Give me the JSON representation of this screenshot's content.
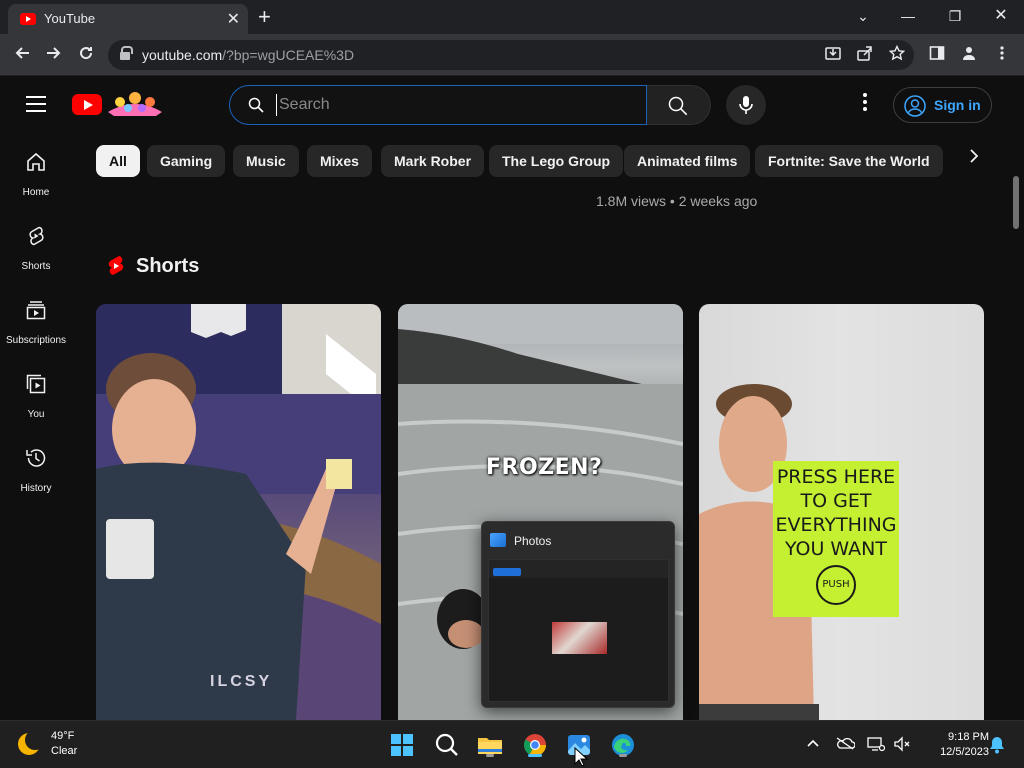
{
  "browser": {
    "tab_title": "YouTube",
    "url_host": "youtube.com",
    "url_path": "/?bp=wgUCEAE%3D",
    "window_buttons": [
      "chevron-down",
      "minimize",
      "restore",
      "close"
    ]
  },
  "youtube": {
    "search": {
      "placeholder": "Search"
    },
    "signin_label": "Sign in",
    "guide": [
      {
        "label": "Home",
        "icon": "home-icon"
      },
      {
        "label": "Shorts",
        "icon": "shorts-icon"
      },
      {
        "label": "Subscriptions",
        "icon": "subscriptions-icon"
      },
      {
        "label": "You",
        "icon": "you-icon"
      },
      {
        "label": "History",
        "icon": "history-icon"
      }
    ],
    "chips": [
      "All",
      "Gaming",
      "Music",
      "Mixes",
      "Mark Rober",
      "The Lego Group",
      "Animated films",
      "Fortnite: Save the World"
    ],
    "meta_line": "1.8M views • 2 weeks ago",
    "shorts_title": "Shorts",
    "shorts": [
      {
        "overlay_text": "ILCSY"
      },
      {
        "overlay_text": "FROZEN?"
      },
      {
        "sign_lines": [
          "PRESS HERE",
          "TO GET",
          "EVERYTHING",
          "YOU WANT"
        ],
        "push_label": "PUSH"
      }
    ]
  },
  "photos_popup": {
    "title": "Photos"
  },
  "taskbar": {
    "weather_temp": "49°F",
    "weather_cond": "Clear",
    "time": "9:18 PM",
    "date": "12/5/2023"
  },
  "colors": {
    "youtube_red": "#ff0000",
    "link_blue": "#3ea6ff",
    "search_focus": "#1c62b9",
    "background": "#0f0f0f"
  }
}
